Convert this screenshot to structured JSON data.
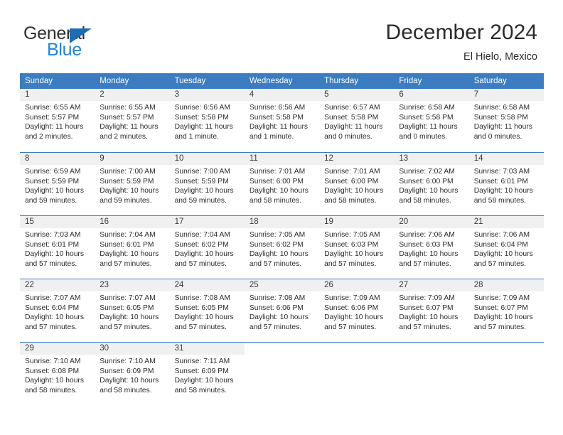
{
  "logo": {
    "word1": "General",
    "word2": "Blue",
    "triangle_color": "#1f6cb5",
    "blue_color": "#2484d0"
  },
  "header": {
    "title": "December 2024",
    "subtitle": "El Hielo, Mexico"
  },
  "theme": {
    "header_blue": "#3b7dc0",
    "daynum_band": "#f0f0f0",
    "text": "#2b2b2b"
  },
  "calendar": {
    "weekdays": [
      "Sunday",
      "Monday",
      "Tuesday",
      "Wednesday",
      "Thursday",
      "Friday",
      "Saturday"
    ],
    "weeks": [
      [
        {
          "day": "1",
          "sunrise": "Sunrise: 6:55 AM",
          "sunset": "Sunset: 5:57 PM",
          "daylight": "Daylight: 11 hours and 2 minutes."
        },
        {
          "day": "2",
          "sunrise": "Sunrise: 6:55 AM",
          "sunset": "Sunset: 5:57 PM",
          "daylight": "Daylight: 11 hours and 2 minutes."
        },
        {
          "day": "3",
          "sunrise": "Sunrise: 6:56 AM",
          "sunset": "Sunset: 5:58 PM",
          "daylight": "Daylight: 11 hours and 1 minute."
        },
        {
          "day": "4",
          "sunrise": "Sunrise: 6:56 AM",
          "sunset": "Sunset: 5:58 PM",
          "daylight": "Daylight: 11 hours and 1 minute."
        },
        {
          "day": "5",
          "sunrise": "Sunrise: 6:57 AM",
          "sunset": "Sunset: 5:58 PM",
          "daylight": "Daylight: 11 hours and 0 minutes."
        },
        {
          "day": "6",
          "sunrise": "Sunrise: 6:58 AM",
          "sunset": "Sunset: 5:58 PM",
          "daylight": "Daylight: 11 hours and 0 minutes."
        },
        {
          "day": "7",
          "sunrise": "Sunrise: 6:58 AM",
          "sunset": "Sunset: 5:58 PM",
          "daylight": "Daylight: 11 hours and 0 minutes."
        }
      ],
      [
        {
          "day": "8",
          "sunrise": "Sunrise: 6:59 AM",
          "sunset": "Sunset: 5:59 PM",
          "daylight": "Daylight: 10 hours and 59 minutes."
        },
        {
          "day": "9",
          "sunrise": "Sunrise: 7:00 AM",
          "sunset": "Sunset: 5:59 PM",
          "daylight": "Daylight: 10 hours and 59 minutes."
        },
        {
          "day": "10",
          "sunrise": "Sunrise: 7:00 AM",
          "sunset": "Sunset: 5:59 PM",
          "daylight": "Daylight: 10 hours and 59 minutes."
        },
        {
          "day": "11",
          "sunrise": "Sunrise: 7:01 AM",
          "sunset": "Sunset: 6:00 PM",
          "daylight": "Daylight: 10 hours and 58 minutes."
        },
        {
          "day": "12",
          "sunrise": "Sunrise: 7:01 AM",
          "sunset": "Sunset: 6:00 PM",
          "daylight": "Daylight: 10 hours and 58 minutes."
        },
        {
          "day": "13",
          "sunrise": "Sunrise: 7:02 AM",
          "sunset": "Sunset: 6:00 PM",
          "daylight": "Daylight: 10 hours and 58 minutes."
        },
        {
          "day": "14",
          "sunrise": "Sunrise: 7:03 AM",
          "sunset": "Sunset: 6:01 PM",
          "daylight": "Daylight: 10 hours and 58 minutes."
        }
      ],
      [
        {
          "day": "15",
          "sunrise": "Sunrise: 7:03 AM",
          "sunset": "Sunset: 6:01 PM",
          "daylight": "Daylight: 10 hours and 57 minutes."
        },
        {
          "day": "16",
          "sunrise": "Sunrise: 7:04 AM",
          "sunset": "Sunset: 6:01 PM",
          "daylight": "Daylight: 10 hours and 57 minutes."
        },
        {
          "day": "17",
          "sunrise": "Sunrise: 7:04 AM",
          "sunset": "Sunset: 6:02 PM",
          "daylight": "Daylight: 10 hours and 57 minutes."
        },
        {
          "day": "18",
          "sunrise": "Sunrise: 7:05 AM",
          "sunset": "Sunset: 6:02 PM",
          "daylight": "Daylight: 10 hours and 57 minutes."
        },
        {
          "day": "19",
          "sunrise": "Sunrise: 7:05 AM",
          "sunset": "Sunset: 6:03 PM",
          "daylight": "Daylight: 10 hours and 57 minutes."
        },
        {
          "day": "20",
          "sunrise": "Sunrise: 7:06 AM",
          "sunset": "Sunset: 6:03 PM",
          "daylight": "Daylight: 10 hours and 57 minutes."
        },
        {
          "day": "21",
          "sunrise": "Sunrise: 7:06 AM",
          "sunset": "Sunset: 6:04 PM",
          "daylight": "Daylight: 10 hours and 57 minutes."
        }
      ],
      [
        {
          "day": "22",
          "sunrise": "Sunrise: 7:07 AM",
          "sunset": "Sunset: 6:04 PM",
          "daylight": "Daylight: 10 hours and 57 minutes."
        },
        {
          "day": "23",
          "sunrise": "Sunrise: 7:07 AM",
          "sunset": "Sunset: 6:05 PM",
          "daylight": "Daylight: 10 hours and 57 minutes."
        },
        {
          "day": "24",
          "sunrise": "Sunrise: 7:08 AM",
          "sunset": "Sunset: 6:05 PM",
          "daylight": "Daylight: 10 hours and 57 minutes."
        },
        {
          "day": "25",
          "sunrise": "Sunrise: 7:08 AM",
          "sunset": "Sunset: 6:06 PM",
          "daylight": "Daylight: 10 hours and 57 minutes."
        },
        {
          "day": "26",
          "sunrise": "Sunrise: 7:09 AM",
          "sunset": "Sunset: 6:06 PM",
          "daylight": "Daylight: 10 hours and 57 minutes."
        },
        {
          "day": "27",
          "sunrise": "Sunrise: 7:09 AM",
          "sunset": "Sunset: 6:07 PM",
          "daylight": "Daylight: 10 hours and 57 minutes."
        },
        {
          "day": "28",
          "sunrise": "Sunrise: 7:09 AM",
          "sunset": "Sunset: 6:07 PM",
          "daylight": "Daylight: 10 hours and 57 minutes."
        }
      ],
      [
        {
          "day": "29",
          "sunrise": "Sunrise: 7:10 AM",
          "sunset": "Sunset: 6:08 PM",
          "daylight": "Daylight: 10 hours and 58 minutes."
        },
        {
          "day": "30",
          "sunrise": "Sunrise: 7:10 AM",
          "sunset": "Sunset: 6:09 PM",
          "daylight": "Daylight: 10 hours and 58 minutes."
        },
        {
          "day": "31",
          "sunrise": "Sunrise: 7:11 AM",
          "sunset": "Sunset: 6:09 PM",
          "daylight": "Daylight: 10 hours and 58 minutes."
        },
        {
          "day": "",
          "sunrise": "",
          "sunset": "",
          "daylight": ""
        },
        {
          "day": "",
          "sunrise": "",
          "sunset": "",
          "daylight": ""
        },
        {
          "day": "",
          "sunrise": "",
          "sunset": "",
          "daylight": ""
        },
        {
          "day": "",
          "sunrise": "",
          "sunset": "",
          "daylight": ""
        }
      ]
    ]
  }
}
